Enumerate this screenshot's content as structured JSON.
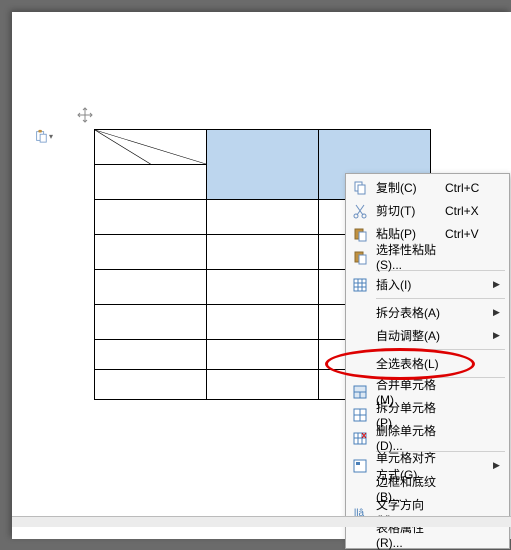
{
  "menu": {
    "copy": {
      "label": "复制(C)",
      "shortcut": "Ctrl+C"
    },
    "cut": {
      "label": "剪切(T)",
      "shortcut": "Ctrl+X"
    },
    "paste": {
      "label": "粘贴(P)",
      "shortcut": "Ctrl+V"
    },
    "paste_special": {
      "label": "选择性粘贴(S)..."
    },
    "insert": {
      "label": "插入(I)"
    },
    "split_table": {
      "label": "拆分表格(A)"
    },
    "auto_fit": {
      "label": "自动调整(A)"
    },
    "select_table": {
      "label": "全选表格(L)"
    },
    "merge_cells": {
      "label": "合并单元格(M)"
    },
    "split_cells": {
      "label": "拆分单元格(P)"
    },
    "delete_cells": {
      "label": "删除单元格(D)..."
    },
    "cell_align": {
      "label": "单元格对齐方式(G)"
    },
    "borders": {
      "label": "边框和底纹(B)..."
    },
    "text_direction": {
      "label": "文字方向(X)..."
    },
    "table_props": {
      "label": "表格属性(R)..."
    }
  },
  "table": {
    "rows": 7,
    "cols": 3,
    "selected_cells": [
      [
        0,
        1
      ],
      [
        0,
        2
      ],
      [
        1,
        1
      ],
      [
        1,
        2
      ]
    ]
  }
}
